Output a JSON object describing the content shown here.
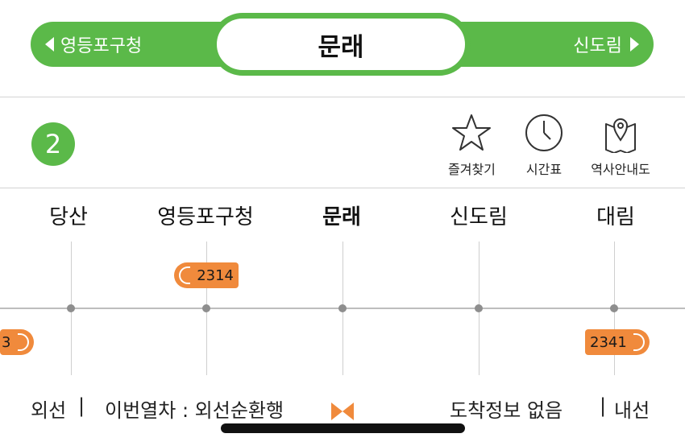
{
  "header": {
    "prev_station": "영등포구청",
    "current_station": "문래",
    "next_station": "신도림"
  },
  "line": {
    "number": "2",
    "color": "#5bb949"
  },
  "tools": [
    {
      "label": "즐겨찾기",
      "icon": "star-icon"
    },
    {
      "label": "시간표",
      "icon": "clock-icon"
    },
    {
      "label": "역사안내도",
      "icon": "map-pin-icon"
    }
  ],
  "stations": [
    "당산",
    "영등포구청",
    "문래",
    "신도림",
    "대림"
  ],
  "trains": [
    {
      "number": "2314",
      "track": "inner",
      "direction": "right"
    },
    {
      "number": "2341",
      "track": "outer",
      "direction": "right"
    },
    {
      "number": "3",
      "track": "outer",
      "direction": "left"
    }
  ],
  "footer": {
    "outer_label": "외선",
    "sep1": "|",
    "next_train": "이번열차 : 외선순환행",
    "arrival": "도착정보 없음",
    "sep2": "|",
    "inner_label": "내선"
  },
  "colors": {
    "accent": "#5bb949",
    "train": "#f08a3c",
    "bowtie": "#f08a3c"
  }
}
